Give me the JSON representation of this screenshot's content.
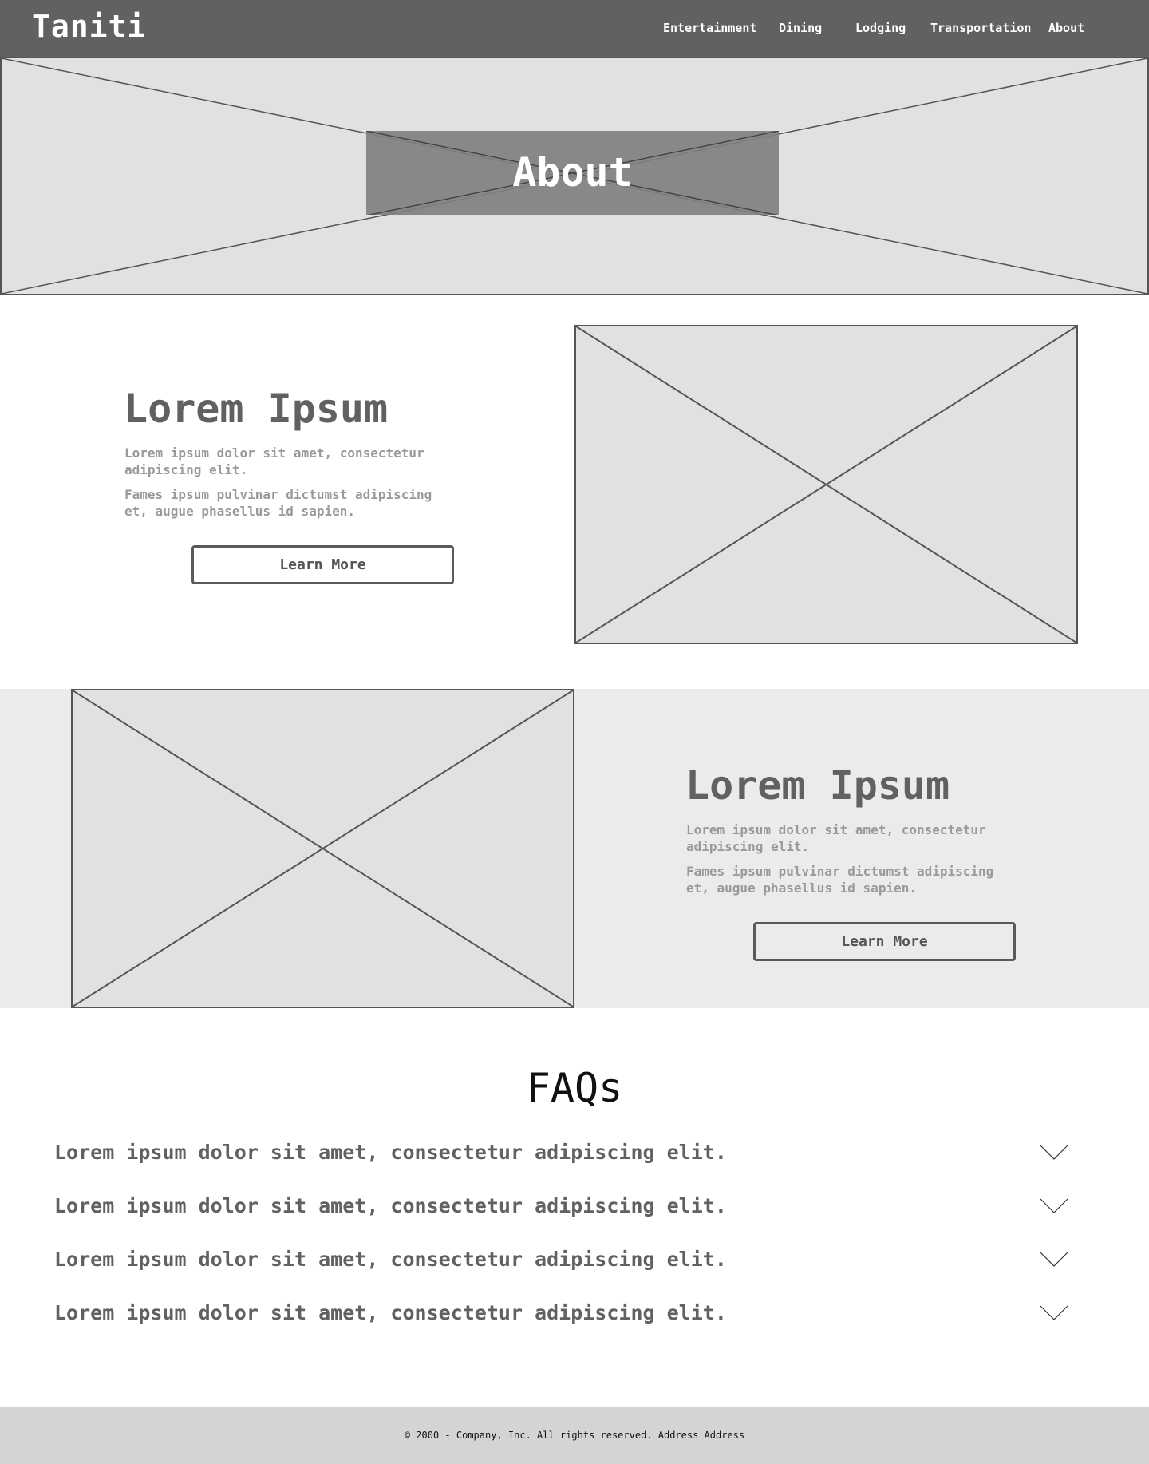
{
  "header": {
    "logo": "Taniti",
    "nav": [
      "Entertainment",
      "Dining",
      "Lodging",
      "Transportation",
      "About"
    ]
  },
  "hero": {
    "title": "About"
  },
  "section1": {
    "heading": "Lorem Ipsum",
    "paragraph1": "Lorem ipsum dolor sit amet, consectetur adipiscing elit.",
    "paragraph2": "Fames ipsum pulvinar dictumst adipiscing et, augue phasellus id sapien.",
    "button": "Learn More"
  },
  "section2": {
    "heading": "Lorem Ipsum",
    "paragraph1": "Lorem ipsum dolor sit amet, consectetur adipiscing elit.",
    "paragraph2": "Fames ipsum pulvinar dictumst adipiscing et, augue phasellus id sapien.",
    "button": "Learn More"
  },
  "faq": {
    "title": "FAQs",
    "items": [
      {
        "question": "Lorem ipsum dolor sit amet, consectetur adipiscing elit.",
        "icon": "chevron-down-icon"
      },
      {
        "question": "Lorem ipsum dolor sit amet, consectetur adipiscing elit.",
        "icon": "chevron-down-icon"
      },
      {
        "question": "Lorem ipsum dolor sit amet, consectetur adipiscing elit.",
        "icon": "chevron-down-icon"
      },
      {
        "question": "Lorem ipsum dolor sit amet, consectetur adipiscing elit.",
        "icon": "chevron-down-icon"
      }
    ]
  },
  "footer": {
    "text": "© 2000 - Company, Inc. All rights reserved. Address Address"
  },
  "colors": {
    "header_bg": "#616161",
    "placeholder_bg": "#e1e1e1",
    "band_bg": "#ebebeb",
    "footer_bg": "#d4d4d4",
    "heading_text": "#616161",
    "body_text": "#999999"
  }
}
